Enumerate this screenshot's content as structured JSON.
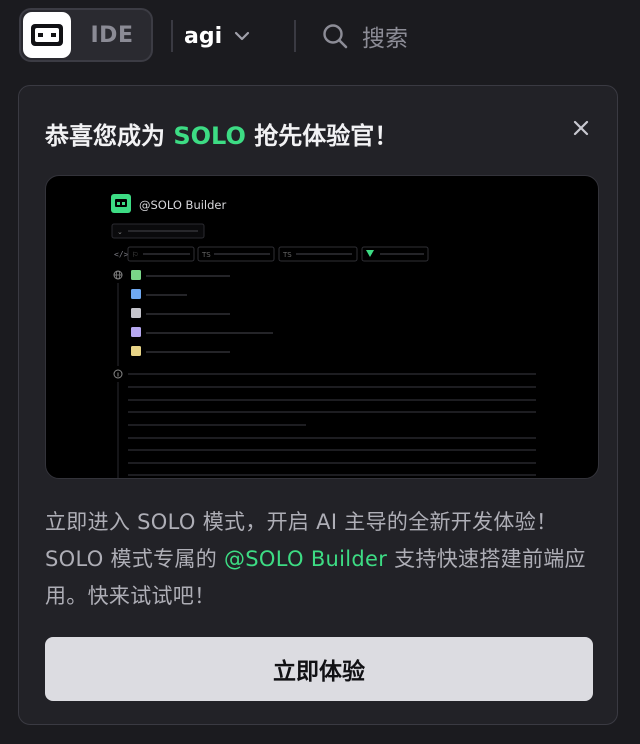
{
  "header": {
    "mode_options": [
      "SOLO",
      "IDE"
    ],
    "ide_label": "IDE",
    "project_name": "agi",
    "search_label": "搜索"
  },
  "popup": {
    "title_before": "恭喜您成为 ",
    "title_accent": "SOLO",
    "title_after": " 抢先体验官！",
    "preview": {
      "builder_label": "@SOLO Builder",
      "chip_labels": [
        "TS",
        "TS"
      ]
    },
    "description_before": "立即进入 SOLO 模式，开启 AI 主导的全新开发体验！SOLO 模式专属的 ",
    "description_accent": "@SOLO Builder",
    "description_after": " 支持快速搭建前端应用。快来试试吧！",
    "cta_label": "立即体验"
  },
  "colors": {
    "accent_green": "#3ddc84",
    "background": "#1b1b1f",
    "card": "#222227",
    "button": "#dcdce1"
  },
  "icons": [
    "solo-mode-icon",
    "chevron-down-icon",
    "search-icon",
    "close-icon",
    "code-icon",
    "globe-icon",
    "info-icon"
  ]
}
